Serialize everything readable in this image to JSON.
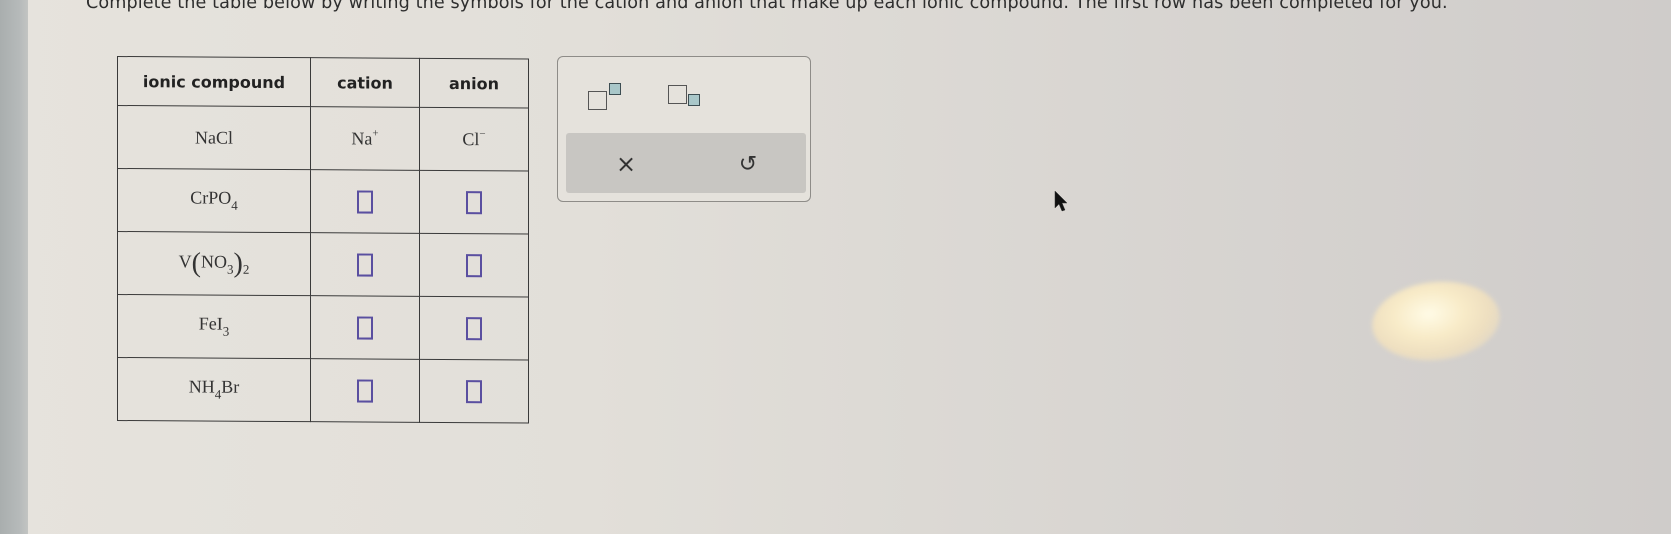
{
  "instructions": "Complete the table below by writing the symbols for the cation and anion that make up each ionic compound. The first row has been completed for you.",
  "table": {
    "headers": [
      "ionic compound",
      "cation",
      "anion"
    ],
    "rows": [
      {
        "compound": {
          "parts": [
            {
              "t": "NaCl"
            }
          ]
        },
        "cation": {
          "filled": true,
          "symbol": "Na",
          "charge": "+"
        },
        "anion": {
          "filled": true,
          "symbol": "Cl",
          "charge": "−"
        }
      },
      {
        "compound": {
          "parts": [
            {
              "t": "CrPO"
            },
            {
              "sub": "4"
            }
          ]
        },
        "cation": {
          "filled": false,
          "value": ""
        },
        "anion": {
          "filled": false,
          "value": ""
        }
      },
      {
        "compound": {
          "parts": [
            {
              "t": "V"
            },
            {
              "paren": "("
            },
            {
              "t": "NO"
            },
            {
              "sub": "3"
            },
            {
              "paren": ")"
            },
            {
              "sub": "2"
            }
          ]
        },
        "cation": {
          "filled": false,
          "value": ""
        },
        "anion": {
          "filled": false,
          "value": ""
        }
      },
      {
        "compound": {
          "parts": [
            {
              "t": "FeI"
            },
            {
              "sub": "3"
            }
          ]
        },
        "cation": {
          "filled": false,
          "value": ""
        },
        "anion": {
          "filled": false,
          "value": ""
        }
      },
      {
        "compound": {
          "parts": [
            {
              "t": "NH"
            },
            {
              "sub": "4"
            },
            {
              "t": "Br"
            }
          ]
        },
        "cation": {
          "filled": false,
          "value": ""
        },
        "anion": {
          "filled": false,
          "value": ""
        }
      }
    ]
  },
  "toolbar": {
    "superscript_button": "superscript-template",
    "subscript_button": "subscript-template",
    "clear_label": "×",
    "undo_label": "↺"
  },
  "colors": {
    "input_border": "#5a4fa0",
    "template_small_box": "#a9c7c9",
    "text": "#333333"
  }
}
